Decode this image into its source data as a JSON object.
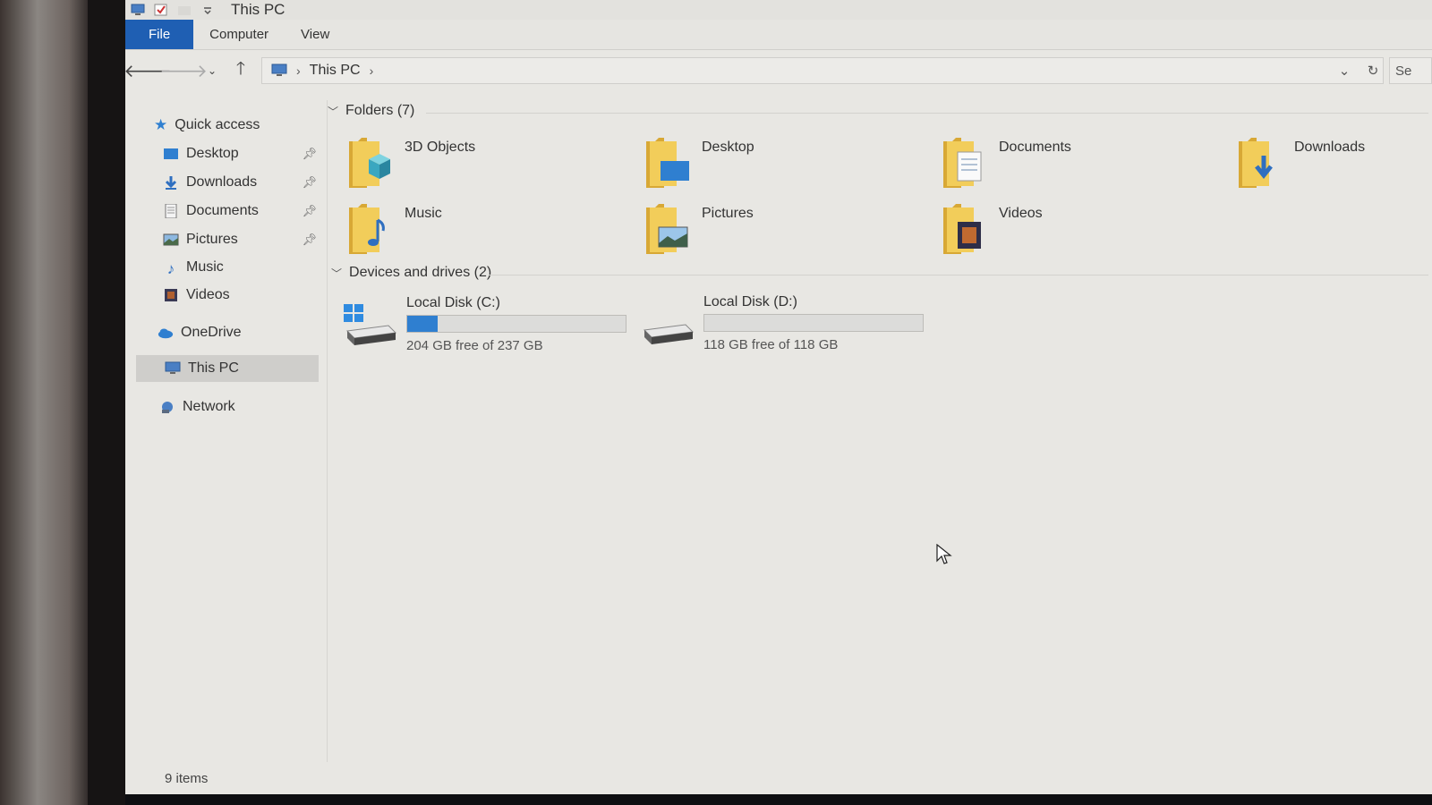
{
  "window": {
    "title": "This PC"
  },
  "ribbon": {
    "tabs": [
      "File",
      "Computer",
      "View"
    ]
  },
  "address": {
    "crumb": "This PC",
    "search_placeholder": "Se"
  },
  "nav": {
    "quick_access": "Quick access",
    "items": [
      {
        "label": "Desktop",
        "icon": "desktop-icon",
        "pinned": true
      },
      {
        "label": "Downloads",
        "icon": "downloads-icon",
        "pinned": true
      },
      {
        "label": "Documents",
        "icon": "documents-icon",
        "pinned": true
      },
      {
        "label": "Pictures",
        "icon": "pictures-icon",
        "pinned": true
      },
      {
        "label": "Music",
        "icon": "music-icon",
        "pinned": false
      },
      {
        "label": "Videos",
        "icon": "videos-icon",
        "pinned": false
      }
    ],
    "onedrive": "OneDrive",
    "this_pc": "This PC",
    "network": "Network"
  },
  "folders": {
    "header": "Folders (7)",
    "items": [
      {
        "name": "3D Objects",
        "icon": "3d-objects-folder-icon"
      },
      {
        "name": "Desktop",
        "icon": "desktop-folder-icon"
      },
      {
        "name": "Documents",
        "icon": "documents-folder-icon"
      },
      {
        "name": "Downloads",
        "icon": "downloads-folder-icon"
      },
      {
        "name": "Music",
        "icon": "music-folder-icon"
      },
      {
        "name": "Pictures",
        "icon": "pictures-folder-icon"
      },
      {
        "name": "Videos",
        "icon": "videos-folder-icon"
      }
    ]
  },
  "drives": {
    "header": "Devices and drives (2)",
    "items": [
      {
        "name": "Local Disk (C:)",
        "free_text": "204 GB free of 237 GB",
        "used_fraction": 0.14,
        "icon": "windows-drive-icon"
      },
      {
        "name": "Local Disk (D:)",
        "free_text": "118 GB free of 118 GB",
        "used_fraction": 0.0,
        "icon": "drive-icon"
      }
    ]
  },
  "status": {
    "items": "9 items"
  },
  "colors": {
    "accent": "#1f5fb3",
    "drive_fill": "#2f7fd0",
    "folder": "#e8b93a"
  }
}
